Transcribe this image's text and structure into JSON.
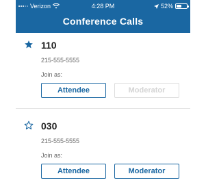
{
  "status_bar": {
    "carrier": "Verizon",
    "time": "4:28 PM",
    "battery_percent": "52%",
    "battery_level": 0.52
  },
  "header": {
    "title": "Conference Calls"
  },
  "conferences": [
    {
      "number": "110",
      "phone": "215-555-5555",
      "favorite": true,
      "join_label": "Join as:",
      "attendee_label": "Attendee",
      "moderator_label": "Moderator",
      "moderator_enabled": false
    },
    {
      "number": "030",
      "phone": "215-555-5555",
      "favorite": false,
      "join_label": "Join as:",
      "attendee_label": "Attendee",
      "moderator_label": "Moderator",
      "moderator_enabled": true
    }
  ],
  "colors": {
    "header_bg": "#1a67a2",
    "accent": "#1a67a2",
    "disabled": "#d4d4d4"
  }
}
